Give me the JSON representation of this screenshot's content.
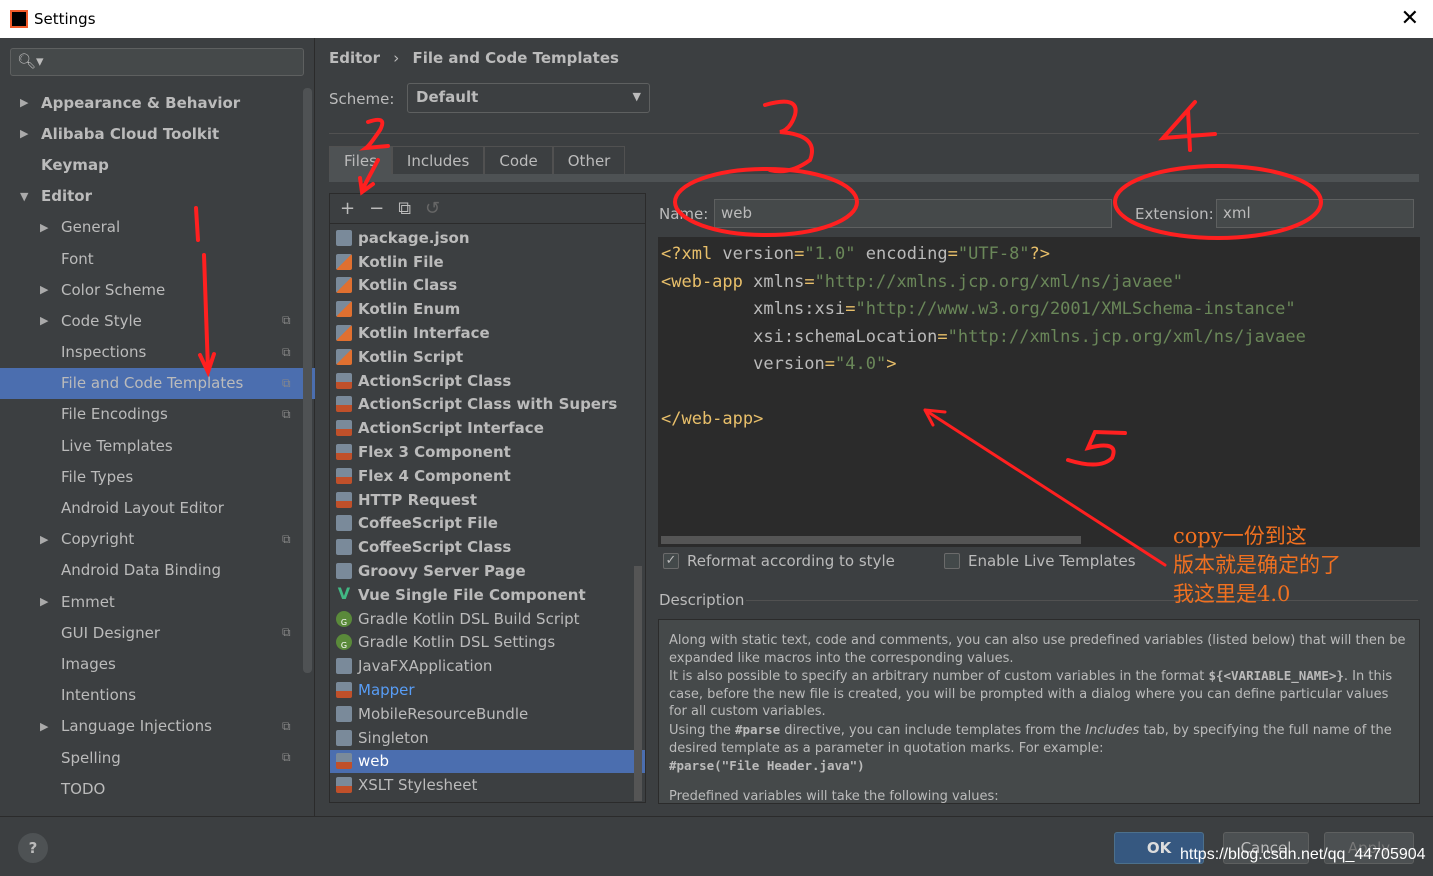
{
  "window": {
    "title": "Settings"
  },
  "sidebar": {
    "items": [
      {
        "label": "Appearance & Behavior",
        "level": 0,
        "arrow": "right",
        "bold": true
      },
      {
        "label": "Alibaba Cloud Toolkit",
        "level": 0,
        "arrow": "right",
        "bold": true
      },
      {
        "label": "Keymap",
        "level": 0,
        "bold": true
      },
      {
        "label": "Editor",
        "level": 0,
        "arrow": "down",
        "bold": true
      },
      {
        "label": "General",
        "level": 1,
        "arrow": "right"
      },
      {
        "label": "Font",
        "level": 1
      },
      {
        "label": "Color Scheme",
        "level": 1,
        "arrow": "right"
      },
      {
        "label": "Code Style",
        "level": 1,
        "arrow": "right",
        "copy": true
      },
      {
        "label": "Inspections",
        "level": 1,
        "copy": true
      },
      {
        "label": "File and Code Templates",
        "level": 1,
        "copy": true,
        "selected": true
      },
      {
        "label": "File Encodings",
        "level": 1,
        "copy": true
      },
      {
        "label": "Live Templates",
        "level": 1
      },
      {
        "label": "File Types",
        "level": 1
      },
      {
        "label": "Android Layout Editor",
        "level": 1
      },
      {
        "label": "Copyright",
        "level": 1,
        "arrow": "right",
        "copy": true
      },
      {
        "label": "Android Data Binding",
        "level": 1
      },
      {
        "label": "Emmet",
        "level": 1,
        "arrow": "right"
      },
      {
        "label": "GUI Designer",
        "level": 1,
        "copy": true
      },
      {
        "label": "Images",
        "level": 1
      },
      {
        "label": "Intentions",
        "level": 1
      },
      {
        "label": "Language Injections",
        "level": 1,
        "arrow": "right",
        "copy": true
      },
      {
        "label": "Spelling",
        "level": 1,
        "copy": true
      },
      {
        "label": "TODO",
        "level": 1
      }
    ]
  },
  "breadcrumb": {
    "parent": "Editor",
    "sep": "›",
    "current": "File and Code Templates"
  },
  "scheme": {
    "label": "Scheme:",
    "value": "Default"
  },
  "tabs": [
    "Files",
    "Includes",
    "Code",
    "Other"
  ],
  "toolbar": {
    "add": "+",
    "remove": "−",
    "copy": "⧉",
    "reset": "↺"
  },
  "templates": [
    {
      "label": "package.json",
      "bold": true,
      "icon": "js"
    },
    {
      "label": "Kotlin File",
      "bold": true,
      "icon": "kotlin"
    },
    {
      "label": "Kotlin Class",
      "bold": true,
      "icon": "kotlin"
    },
    {
      "label": "Kotlin Enum",
      "bold": true,
      "icon": "kotlin"
    },
    {
      "label": "Kotlin Interface",
      "bold": true,
      "icon": "kotlin"
    },
    {
      "label": "Kotlin Script",
      "bold": true,
      "icon": "kotlin"
    },
    {
      "label": "ActionScript Class",
      "bold": true,
      "icon": "AS"
    },
    {
      "label": "ActionScript Class with Supers",
      "bold": true,
      "icon": "AS"
    },
    {
      "label": "ActionScript Interface",
      "bold": true,
      "icon": "AS"
    },
    {
      "label": "Flex 3 Component",
      "bold": true,
      "icon": "<>"
    },
    {
      "label": "Flex 4 Component",
      "bold": true,
      "icon": "<>"
    },
    {
      "label": "HTTP Request",
      "bold": true,
      "icon": "API"
    },
    {
      "label": "CoffeeScript File",
      "bold": true,
      "icon": "coffee"
    },
    {
      "label": "CoffeeScript Class",
      "bold": true,
      "icon": "coffee"
    },
    {
      "label": "Groovy Server Page",
      "bold": true,
      "icon": "gsp"
    },
    {
      "label": "Vue Single File Component",
      "bold": true,
      "icon": "V"
    },
    {
      "label": "Gradle Kotlin DSL Build Script",
      "icon": "G"
    },
    {
      "label": "Gradle Kotlin DSL Settings",
      "icon": "G"
    },
    {
      "label": "JavaFXApplication",
      "icon": "J"
    },
    {
      "label": "Mapper",
      "icon": "<>",
      "link": true
    },
    {
      "label": "MobileResourceBundle",
      "icon": "file"
    },
    {
      "label": "Singleton",
      "icon": "J"
    },
    {
      "label": "web",
      "icon": "<>",
      "selected": true
    },
    {
      "label": "XSLT Stylesheet",
      "icon": "<>"
    }
  ],
  "name": {
    "label": "Name:",
    "value": "web"
  },
  "extension": {
    "label": "Extension:",
    "value": "xml"
  },
  "code": {
    "lines": [
      [
        [
          "t",
          "<?xml "
        ],
        [
          "a",
          "version"
        ],
        [
          "t",
          "="
        ],
        [
          "v",
          "\"1.0\""
        ],
        [
          "a",
          " encoding"
        ],
        [
          "t",
          "="
        ],
        [
          "v",
          "\"UTF-8\""
        ],
        [
          "t",
          "?>"
        ]
      ],
      [
        [
          "t",
          "<web-app "
        ],
        [
          "a",
          "xmlns"
        ],
        [
          "t",
          "="
        ],
        [
          "v",
          "\"http://xmlns.jcp.org/xml/ns/javaee\""
        ]
      ],
      [
        [
          "a",
          "         xmlns:xsi"
        ],
        [
          "t",
          "="
        ],
        [
          "v",
          "\"http://www.w3.org/2001/XMLSchema-instance\""
        ]
      ],
      [
        [
          "a",
          "         xsi:schemaLocation"
        ],
        [
          "t",
          "="
        ],
        [
          "v",
          "\"http://xmlns.jcp.org/xml/ns/javaee"
        ]
      ],
      [
        [
          "a",
          "         version"
        ],
        [
          "t",
          "="
        ],
        [
          "v",
          "\"4.0\""
        ],
        [
          "t",
          ">"
        ]
      ],
      [
        [
          "a",
          ""
        ]
      ],
      [
        [
          "t",
          "</web-app>"
        ]
      ]
    ]
  },
  "options": {
    "reformat": {
      "label": "Reformat according to style",
      "checked": true
    },
    "live": {
      "label": "Enable Live Templates",
      "checked": false
    }
  },
  "description": {
    "label": "Description",
    "p1": "Along with static text, code and comments, you can also use predefined variables (listed below) that will then be expanded like macros into the corresponding values.",
    "p2a": "It is also possible to specify an arbitrary number of custom variables in the format ",
    "p2code": "${<VARIABLE_NAME>}",
    "p2b": ". In this case, before the new file is created, you will be prompted with a dialog where you can define particular values for all custom variables.",
    "p3a": "Using the ",
    "p3code": "#parse",
    "p3b": " directive, you can include templates from the ",
    "p3i": "Includes",
    "p3c": " tab, by specifying the full name of the desired template as a parameter in quotation marks. For example:",
    "p4": "#parse(\"File Header.java\")",
    "p5": "Predefined variables will take the following values:"
  },
  "footer": {
    "help": "?",
    "ok": "OK",
    "cancel": "Cancel",
    "apply": "Apply"
  },
  "annotations": {
    "numbers": [
      "1",
      "2",
      "3",
      "4",
      "5"
    ],
    "note": [
      "copy一份到这",
      "版本就是确定的了",
      "我这里是4.0"
    ],
    "color": "#ff2020",
    "note_color": "#f07020"
  },
  "watermark": "https://blog.csdn.net/qq_44705904",
  "colors": {
    "selection": "#4b6eaf",
    "panel": "#3c3f41",
    "editor": "#2b2b2b"
  }
}
